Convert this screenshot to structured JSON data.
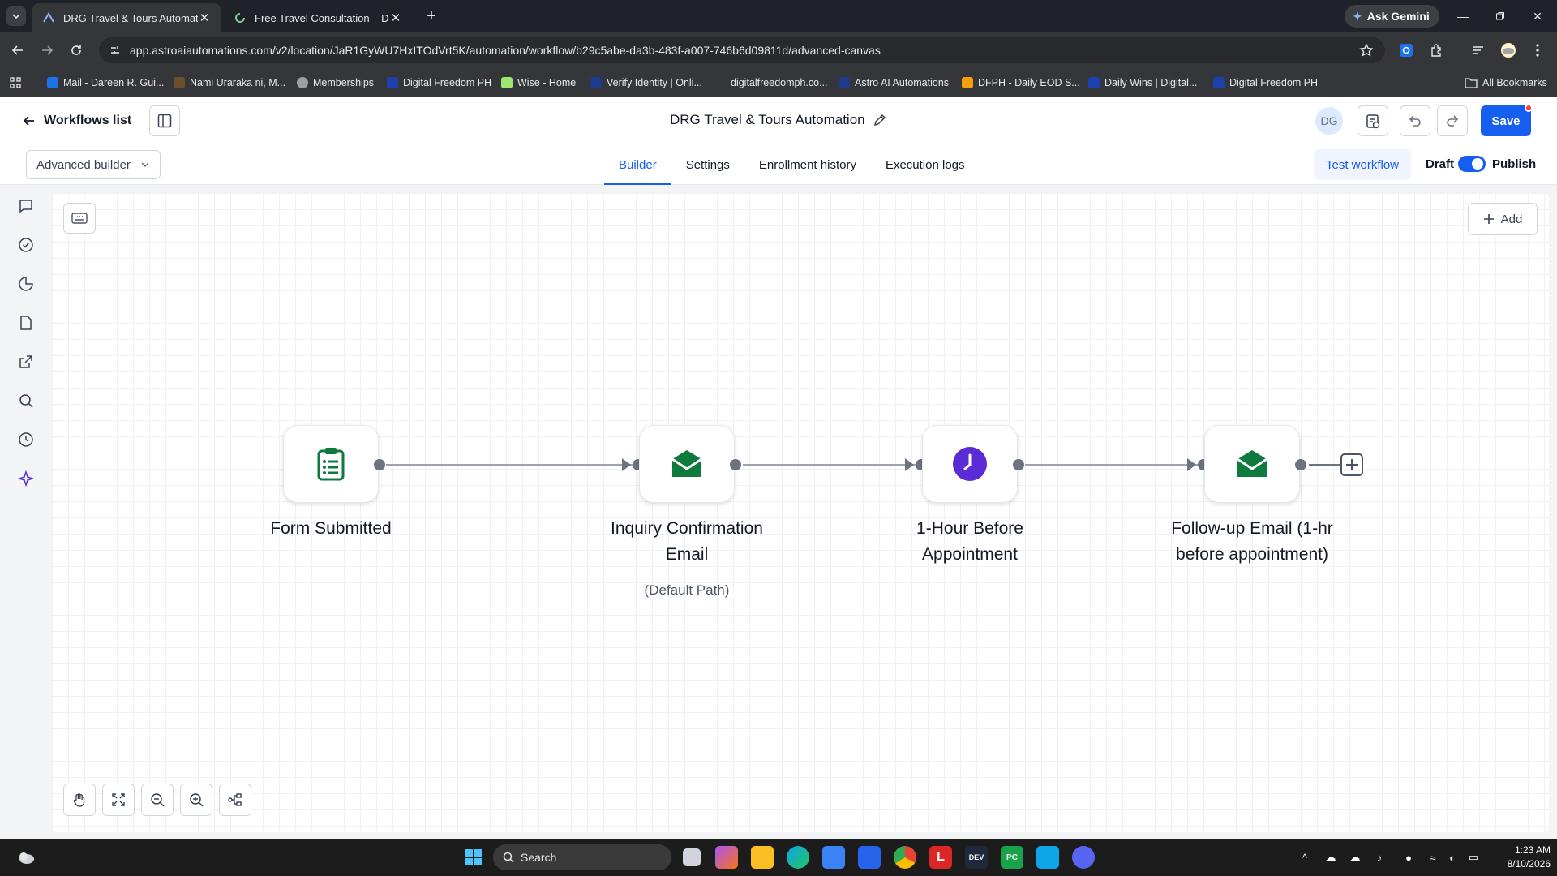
{
  "browser": {
    "tabs": [
      {
        "title": "DRG Travel & Tours Automation",
        "active": true
      },
      {
        "title": "Free Travel Consultation – DRG",
        "active": false
      }
    ],
    "gemini_label": "Ask Gemini",
    "url": "app.astroaiautomations.com/v2/location/JaR1GyWU7HxITOdVrt5K/automation/workflow/b29c5abe-da3b-483f-a007-746b6d09811d/advanced-canvas",
    "bookmarks": [
      {
        "label": "Mail - Dareen R. Gui...",
        "color": "#1a73e8"
      },
      {
        "label": "Nami Uraraka ni, M...",
        "color": "#6b4f2a"
      },
      {
        "label": "Memberships",
        "color": "#9aa0a6"
      },
      {
        "label": "Digital Freedom PH",
        "color": "#1e40af"
      },
      {
        "label": "Wise - Home",
        "color": "#9fe870"
      },
      {
        "label": "Verify Identity | Onli...",
        "color": "#1e3a8a"
      },
      {
        "label": "digitalfreedomph.co...",
        "color": "#35363a"
      },
      {
        "label": "Astro AI Automations",
        "color": "#1e3a8a"
      },
      {
        "label": "DFPH - Daily EOD S...",
        "color": "#f59e0b"
      },
      {
        "label": "Daily Wins | Digital...",
        "color": "#1e40af"
      },
      {
        "label": "Digital Freedom PH",
        "color": "#1e40af"
      }
    ],
    "all_bookmarks": "All Bookmarks"
  },
  "header": {
    "back_label": "Workflows list",
    "title": "DRG Travel & Tours Automation",
    "avatar_initials": "DG",
    "save_label": "Save"
  },
  "subbar": {
    "builder_mode": "Advanced builder",
    "tabs": [
      "Builder",
      "Settings",
      "Enrollment history",
      "Execution logs"
    ],
    "active_tab": "Builder",
    "test_label": "Test workflow",
    "draft_label": "Draft",
    "publish_label": "Publish",
    "published": true
  },
  "canvas": {
    "add_label": "Add",
    "nodes": [
      {
        "label": "Form Submitted",
        "sub": "",
        "icon": "clipboard-list-icon"
      },
      {
        "label": "Inquiry Confirmation Email",
        "sub": "(Default Path)",
        "icon": "envelope-icon"
      },
      {
        "label": "1-Hour Before Appointment",
        "sub": "",
        "icon": "clock-icon"
      },
      {
        "label": "Follow-up Email (1-hr before appointment)",
        "sub": "",
        "icon": "envelope-icon"
      }
    ]
  },
  "colors": {
    "accent": "#155eef",
    "email_green": "#0f7a3e",
    "wait_purple": "#5b2bd6"
  },
  "taskbar": {
    "search_placeholder": "Search",
    "time": "1:23 AM",
    "date": "8/10/2026"
  }
}
